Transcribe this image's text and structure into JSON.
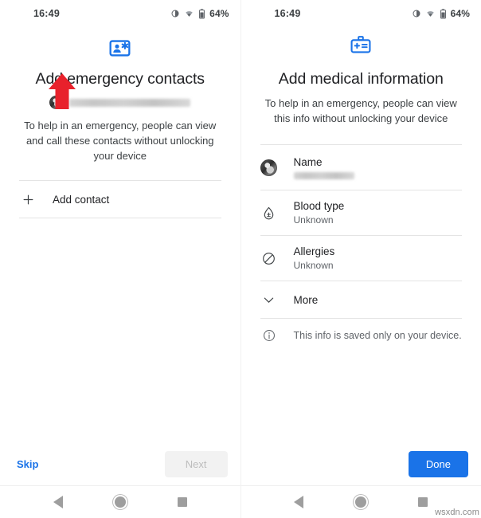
{
  "statusbar": {
    "time": "16:49",
    "battery_percent": "64%",
    "icons": [
      "brightness-icon",
      "wifi-icon",
      "battery-icon"
    ]
  },
  "left_screen": {
    "hero_icon": "emergency-contact-card-icon",
    "title": "Add emergency contacts",
    "account_email_redacted": true,
    "subtitle": "To help in an emergency, people can view and call these contacts without unlocking your device",
    "add_contact": {
      "icon": "plus-icon",
      "label": "Add contact"
    },
    "annotation": {
      "shape": "arrow-up",
      "color": "#e8212b"
    },
    "footer": {
      "skip_label": "Skip",
      "next_label": "Next",
      "next_disabled": true
    }
  },
  "right_screen": {
    "hero_icon": "medical-badge-icon",
    "title": "Add medical information",
    "subtitle": "To help in an emergency, people can view this info without unlocking your device",
    "rows": [
      {
        "icon": "avatar-icon",
        "label": "Name",
        "value": "",
        "value_redacted": true
      },
      {
        "icon": "blood-drop-icon",
        "label": "Blood type",
        "value": "Unknown",
        "value_redacted": false
      },
      {
        "icon": "no-entry-icon",
        "label": "Allergies",
        "value": "Unknown",
        "value_redacted": false
      },
      {
        "icon": "chevron-down-icon",
        "label": "More",
        "value": "",
        "value_redacted": false
      }
    ],
    "note": {
      "icon": "info-icon",
      "text": "This info is saved only on your device."
    },
    "footer": {
      "done_label": "Done"
    }
  },
  "navbar": {
    "back_label": "back-button",
    "home_label": "home-button",
    "recents_label": "recents-button"
  },
  "watermark": "wsxdn.com",
  "colors": {
    "accent_blue": "#1a73e8",
    "icon_blue": "#1a73e8",
    "arrow_red": "#e8212b",
    "divider": "#e4e4e4",
    "text_primary": "#202124",
    "text_secondary": "#5f6368"
  }
}
